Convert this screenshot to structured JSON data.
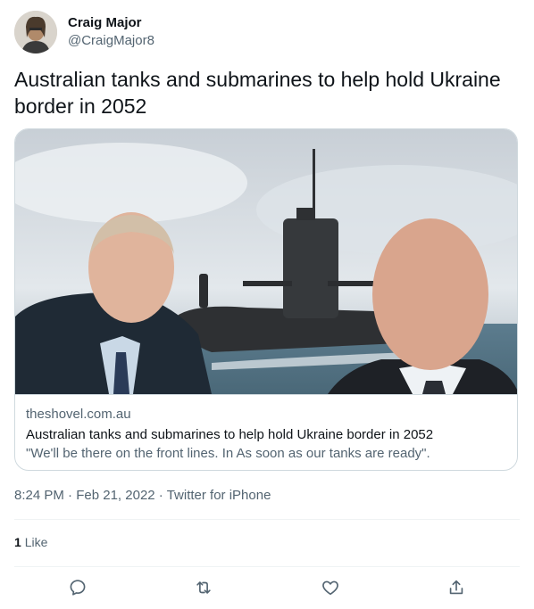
{
  "author": {
    "display_name": "Craig Major",
    "handle": "@CraigMajor8"
  },
  "tweet": {
    "text": "Australian tanks and submarines to help hold Ukraine border in 2052"
  },
  "card": {
    "domain": "theshovel.com.au",
    "title": "Australian tanks and submarines to help hold Ukraine border in 2052",
    "description": "\"We'll be there on the front lines. In As soon as our tanks are ready\"."
  },
  "meta": {
    "time": "8:24 PM",
    "date": "Feb 21, 2022",
    "source": "Twitter for iPhone",
    "sep": "·"
  },
  "stats": {
    "likes_count": "1",
    "likes_label": "Like"
  },
  "actions": [
    {
      "name": "reply",
      "icon": "reply-icon"
    },
    {
      "name": "retweet",
      "icon": "retweet-icon"
    },
    {
      "name": "like",
      "icon": "heart-icon"
    },
    {
      "name": "share",
      "icon": "share-icon"
    }
  ],
  "colors": {
    "text_primary": "#0f1419",
    "text_secondary": "#536471",
    "border": "#cfd9de",
    "divider": "#eff3f4"
  }
}
